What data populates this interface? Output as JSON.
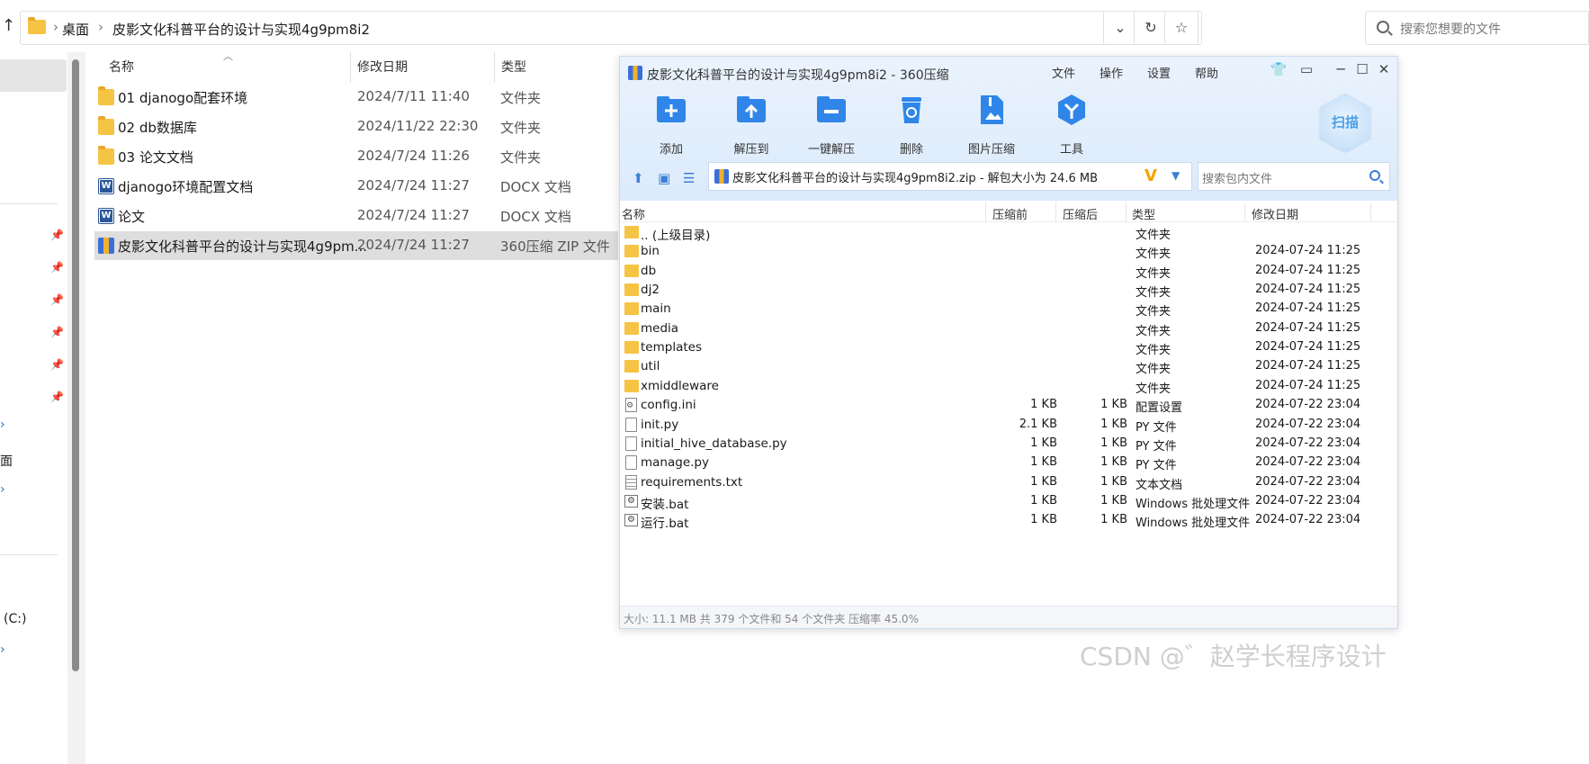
{
  "explorer": {
    "breadcrumbs": [
      "桌面",
      "皮影文化科普平台的设计与实现4g9pm8i2"
    ],
    "search_placeholder": "搜索您想要的文件",
    "columns": {
      "name": "名称",
      "date": "修改日期",
      "type": "类型"
    },
    "files": [
      {
        "name": "01 djanogo配套环境",
        "date": "2024/7/11 11:40",
        "type": "文件夹",
        "icon": "folder-icon"
      },
      {
        "name": "02 db数据库",
        "date": "2024/11/22 22:30",
        "type": "文件夹",
        "icon": "folder-icon"
      },
      {
        "name": "03 论文文档",
        "date": "2024/7/24 11:26",
        "type": "文件夹",
        "icon": "folder-icon"
      },
      {
        "name": "djanogo环境配置文档",
        "date": "2024/7/24 11:27",
        "type": "DOCX 文档",
        "icon": "word-doc-icon"
      },
      {
        "name": "论文",
        "date": "2024/7/24 11:27",
        "type": "DOCX 文档",
        "icon": "word-doc-icon"
      },
      {
        "name": "皮影文化科普平台的设计与实现4g9pm...",
        "date": "2024/7/24 11:27",
        "type": "360压缩 ZIP 文件",
        "icon": "zip-archive-icon",
        "selected": true
      }
    ],
    "nav_fragments": [
      "桌面",
      "(C:)"
    ]
  },
  "zip": {
    "title": "皮影文化科普平台的设计与实现4g9pm8i2 - 360压缩",
    "menu": [
      "文件",
      "操作",
      "设置",
      "帮助"
    ],
    "toolbar": [
      "添加",
      "解压到",
      "一键解压",
      "删除",
      "图片压缩",
      "工具"
    ],
    "scan_label": "扫描",
    "path_text": "皮影文化科普平台的设计与实现4g9pm8i2.zip - 解包大小为 24.6 MB",
    "search_placeholder": "搜索包内文件",
    "columns": {
      "name": "名称",
      "before": "压缩前",
      "after": "压缩后",
      "type": "类型",
      "date": "修改日期"
    },
    "entries": [
      {
        "name": ".. (上级目录)",
        "before": "",
        "after": "",
        "type": "文件夹",
        "date": "",
        "icon": "folder"
      },
      {
        "name": "bin",
        "before": "",
        "after": "",
        "type": "文件夹",
        "date": "2024-07-24 11:25",
        "icon": "folder"
      },
      {
        "name": "db",
        "before": "",
        "after": "",
        "type": "文件夹",
        "date": "2024-07-24 11:25",
        "icon": "folder"
      },
      {
        "name": "dj2",
        "before": "",
        "after": "",
        "type": "文件夹",
        "date": "2024-07-24 11:25",
        "icon": "folder"
      },
      {
        "name": "main",
        "before": "",
        "after": "",
        "type": "文件夹",
        "date": "2024-07-24 11:25",
        "icon": "folder"
      },
      {
        "name": "media",
        "before": "",
        "after": "",
        "type": "文件夹",
        "date": "2024-07-24 11:25",
        "icon": "folder"
      },
      {
        "name": "templates",
        "before": "",
        "after": "",
        "type": "文件夹",
        "date": "2024-07-24 11:25",
        "icon": "folder"
      },
      {
        "name": "util",
        "before": "",
        "after": "",
        "type": "文件夹",
        "date": "2024-07-24 11:25",
        "icon": "folder"
      },
      {
        "name": "xmiddleware",
        "before": "",
        "after": "",
        "type": "文件夹",
        "date": "2024-07-24 11:25",
        "icon": "folder"
      },
      {
        "name": "config.ini",
        "before": "1 KB",
        "after": "1 KB",
        "type": "配置设置",
        "date": "2024-07-22 23:04",
        "icon": "cfg"
      },
      {
        "name": "init.py",
        "before": "2.1 KB",
        "after": "1 KB",
        "type": "PY 文件",
        "date": "2024-07-22 23:04",
        "icon": "file"
      },
      {
        "name": "initial_hive_database.py",
        "before": "1 KB",
        "after": "1 KB",
        "type": "PY 文件",
        "date": "2024-07-22 23:04",
        "icon": "file"
      },
      {
        "name": "manage.py",
        "before": "1 KB",
        "after": "1 KB",
        "type": "PY 文件",
        "date": "2024-07-22 23:04",
        "icon": "file"
      },
      {
        "name": "requirements.txt",
        "before": "1 KB",
        "after": "1 KB",
        "type": "文本文档",
        "date": "2024-07-22 23:04",
        "icon": "txt"
      },
      {
        "name": "安装.bat",
        "before": "1 KB",
        "after": "1 KB",
        "type": "Windows 批处理文件",
        "date": "2024-07-22 23:04",
        "icon": "bat"
      },
      {
        "name": "运行.bat",
        "before": "1 KB",
        "after": "1 KB",
        "type": "Windows 批处理文件",
        "date": "2024-07-22 23:04",
        "icon": "bat"
      }
    ],
    "status": "大小: 11.1 MB 共 379 个文件和 54 个文件夹 压缩率 45.0%"
  },
  "watermark": "CSDN @゛赵学长程序设计"
}
